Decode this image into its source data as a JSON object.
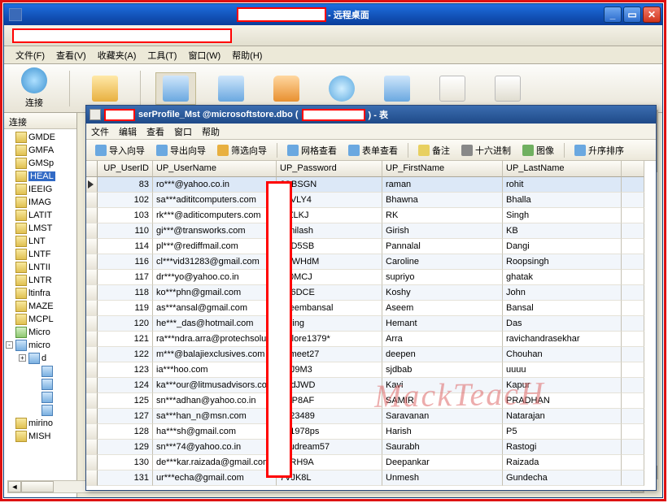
{
  "window": {
    "title_suffix": " - 远程桌面"
  },
  "menu": {
    "file": "文件(F)",
    "view": "查看(V)",
    "favorites": "收藏夹(A)",
    "tools": "工具(T)",
    "window": "窗口(W)",
    "help": "帮助(H)"
  },
  "toolbar": {
    "connect": "连接"
  },
  "leftpanel": {
    "header": "连接"
  },
  "tree": [
    {
      "t": "GMDE"
    },
    {
      "t": "GMFA"
    },
    {
      "t": "GMSp"
    },
    {
      "t": "HEAL",
      "sel": true
    },
    {
      "t": "IEEIG"
    },
    {
      "t": "IMAG"
    },
    {
      "t": "LATIT"
    },
    {
      "t": "LMST"
    },
    {
      "t": "LNT"
    },
    {
      "t": "LNTF"
    },
    {
      "t": "LNTII"
    },
    {
      "t": "LNTR"
    },
    {
      "t": "ltinfra"
    },
    {
      "t": "MAZE"
    },
    {
      "t": "MCPL"
    },
    {
      "t": "Micro",
      "cls": "g"
    },
    {
      "t": "micro",
      "cls": "b",
      "exp": "-",
      "lvl": 0
    },
    {
      "t": "d",
      "cls": "b",
      "exp": "+",
      "lvl": 1
    },
    {
      "t": "",
      "cls": "b",
      "lvl": 2
    },
    {
      "t": "",
      "cls": "b",
      "lvl": 2
    },
    {
      "t": "",
      "cls": "b",
      "lvl": 2
    },
    {
      "t": "",
      "cls": "b",
      "lvl": 2
    },
    {
      "t": "mirino"
    },
    {
      "t": "MISH"
    }
  ],
  "mdi": {
    "title_mid": "serProfile_Mst @microsoftstore.dbo (",
    "title_end": ") - 表",
    "menu": {
      "file": "文件",
      "edit": "编辑",
      "view": "查看",
      "window": "窗口",
      "help": "帮助"
    },
    "toolbar": {
      "import": "导入向导",
      "export": "导出向导",
      "filter": "筛选向导",
      "gridview": "网格查看",
      "formview": "表单查看",
      "memo": "备注",
      "hex": "十六进制",
      "image": "图像",
      "sort": "升序排序"
    }
  },
  "columns": {
    "c1": "UP_UserID",
    "c2": "UP_UserName",
    "c3": "UP_Password",
    "c4": "UP_FirstName",
    "c5": "UP_LastName"
  },
  "rows": [
    {
      "id": "83",
      "u": "ro***@yahoo.co.in",
      "p": "JQBSGN",
      "f": "raman",
      "l": "rohit",
      "sel": true
    },
    {
      "id": "102",
      "u": "sa***adititcomputers.com",
      "p": "T8VLY4",
      "f": "Bhawna",
      "l": "Bhalla"
    },
    {
      "id": "103",
      "u": "rk***@aditicomputers.com",
      "p": "9rZLKJ",
      "f": "RK",
      "l": "Singh"
    },
    {
      "id": "110",
      "u": "gi***@transworks.com",
      "p": "abhilash",
      "f": "Girish",
      "l": "KB"
    },
    {
      "id": "114",
      "u": "pl***@rediffmail.com",
      "p": "CJD5SB",
      "f": "Pannalal",
      "l": "Dangi"
    },
    {
      "id": "116",
      "u": "cl***vid31283@gmail.com",
      "p": "4QWHdM",
      "f": "Caroline",
      "l": "Roopsingh"
    },
    {
      "id": "117",
      "u": "dr***yo@yahoo.co.in",
      "p": "Dt0MCJ",
      "f": "supriyo",
      "l": "ghatak"
    },
    {
      "id": "118",
      "u": "ko***phn@gmail.com",
      "p": "P46DCE",
      "f": "Koshy",
      "l": "John"
    },
    {
      "id": "119",
      "u": "as***ansal@gmail.com",
      "p": "aseembansal",
      "f": "Aseem",
      "l": "Bansal"
    },
    {
      "id": "120",
      "u": "he***_das@hotmail.com",
      "p": "spring",
      "f": "Hemant",
      "l": "Das"
    },
    {
      "id": "121",
      "u": "ra***ndra.arra@protechsolu",
      "p": "nellore1379*",
      "f": "Arra",
      "l": "ravichandrasekhar"
    },
    {
      "id": "122",
      "u": "m***@balajiexclusives.com",
      "p": "sumeet27",
      "f": "deepen",
      "l": "Chouhan"
    },
    {
      "id": "123",
      "u": "ia***hoo.com",
      "p": "dTJ9M3",
      "f": "sjdbab",
      "l": "uuuu"
    },
    {
      "id": "124",
      "u": "ka***our@litmusadvisors.co",
      "p": "yUdJWD",
      "f": "Kavi",
      "l": "Kapur"
    },
    {
      "id": "125",
      "u": "sn***adhan@yahoo.co.in",
      "p": "KXP8AF",
      "f": "SAMIR",
      "l": "PRADHAN"
    },
    {
      "id": "127",
      "u": "sa***han_n@msn.com",
      "p": "2423489",
      "f": "Saravanan",
      "l": "Natarajan"
    },
    {
      "id": "128",
      "u": "ha***sh@gmail.com",
      "p": "671978ps",
      "f": "Harish",
      "l": "P5"
    },
    {
      "id": "129",
      "u": "sn***74@yahoo.co.in",
      "p": "youdream57",
      "f": "Saurabh",
      "l": "Rastogi"
    },
    {
      "id": "130",
      "u": "de***kar.raizada@gmail.com",
      "p": "VyRH9A",
      "f": "Deepankar",
      "l": "Raizada"
    },
    {
      "id": "131",
      "u": "ur***echa@gmail.com",
      "p": "7VJK8L",
      "f": "Unmesh",
      "l": "Gundecha"
    }
  ],
  "watermark": "MackTeacH"
}
